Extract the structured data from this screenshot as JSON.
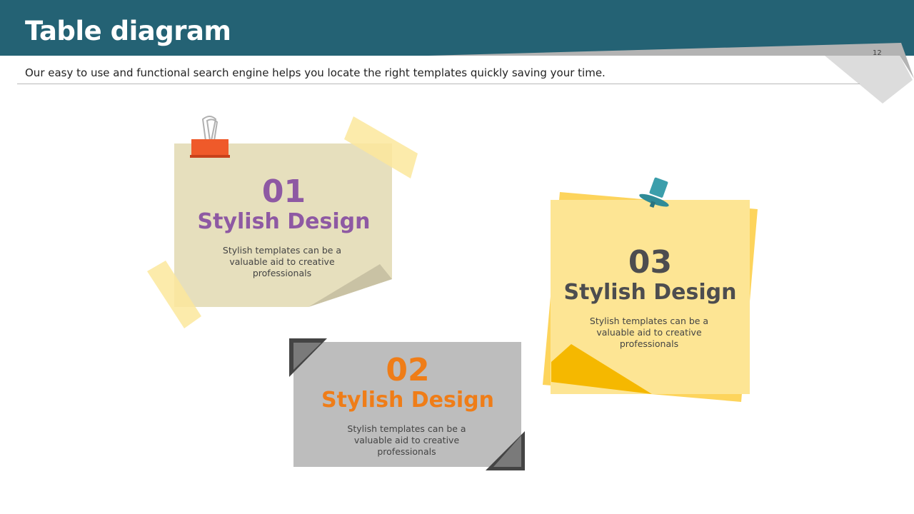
{
  "header": {
    "title": "Table diagram",
    "subtitle": "Our easy to use and functional search engine helps you locate the right templates quickly saving your time.",
    "page_number": "12"
  },
  "cards": [
    {
      "number": "01",
      "heading": "Stylish Design",
      "body_lines": [
        "Stylish templates can be a",
        "valuable aid to  creative",
        "professionals"
      ],
      "accent_color": "#8e59a3",
      "bg_color": "#e6dfbd",
      "pin_icon": "binder-clip-icon"
    },
    {
      "number": "02",
      "heading": "Stylish Design",
      "body_lines": [
        "Stylish templates can be a",
        "valuable aid to  creative",
        "professionals"
      ],
      "accent_color": "#ef7d18",
      "bg_color": "#bdbdbd",
      "pin_icon": "photo-corner-icon"
    },
    {
      "number": "03",
      "heading": "Stylish Design",
      "body_lines": [
        "Stylish templates can be a",
        "valuable aid to  creative",
        "professionals"
      ],
      "accent_color": "#4d4d4f",
      "bg_color": "#fde594",
      "pin_icon": "push-pin-icon"
    }
  ],
  "colors": {
    "header_bg": "#246274",
    "fold_gray": "#b3b3b3",
    "tape_yellow": "#fbe79c"
  }
}
